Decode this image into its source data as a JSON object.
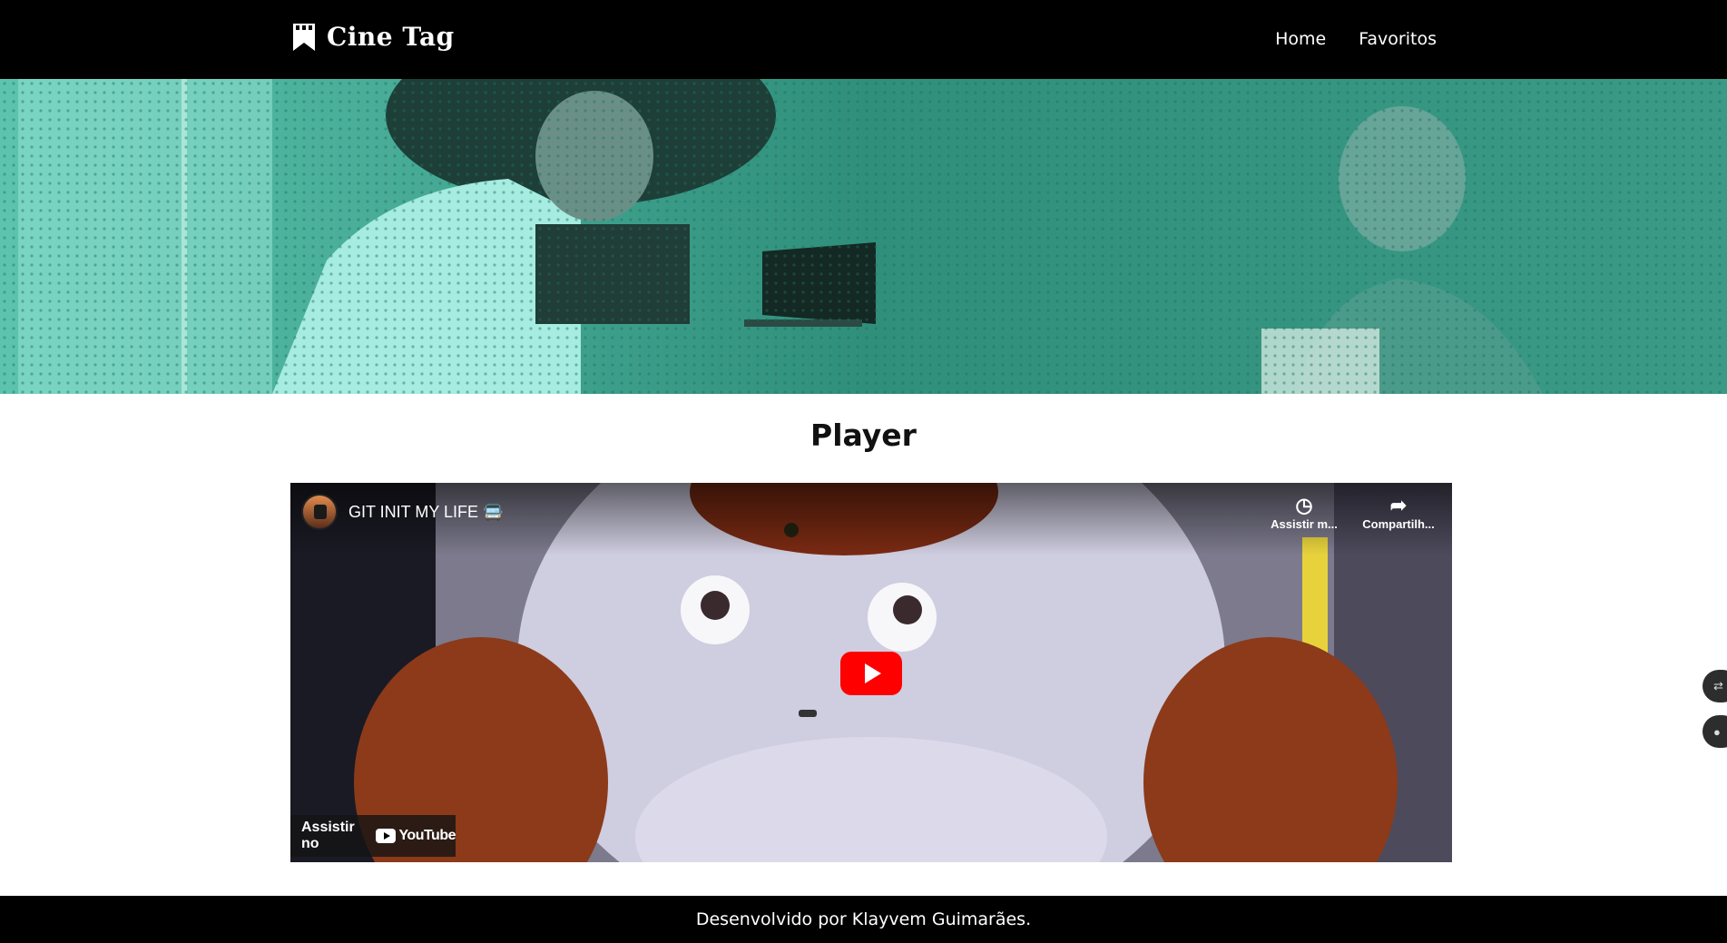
{
  "header": {
    "logo_text": "Cine Tag",
    "nav": [
      {
        "label": "Home"
      },
      {
        "label": "Favoritos"
      }
    ]
  },
  "page": {
    "title": "Player"
  },
  "player": {
    "video_title": "GIT INIT MY LIFE 🚍",
    "actions": [
      {
        "label": "Assistir m...",
        "icon": "clock-icon"
      },
      {
        "label": "Compartilh...",
        "icon": "share-icon"
      }
    ],
    "watch_on_label": "Assistir no",
    "youtube_brand": "YouTube"
  },
  "footer": {
    "text": "Desenvolvido por Klayvem Guimarães."
  },
  "colors": {
    "banner_teal": "#3a9a86",
    "header_bg": "#000000",
    "play_red": "#ff0000"
  }
}
